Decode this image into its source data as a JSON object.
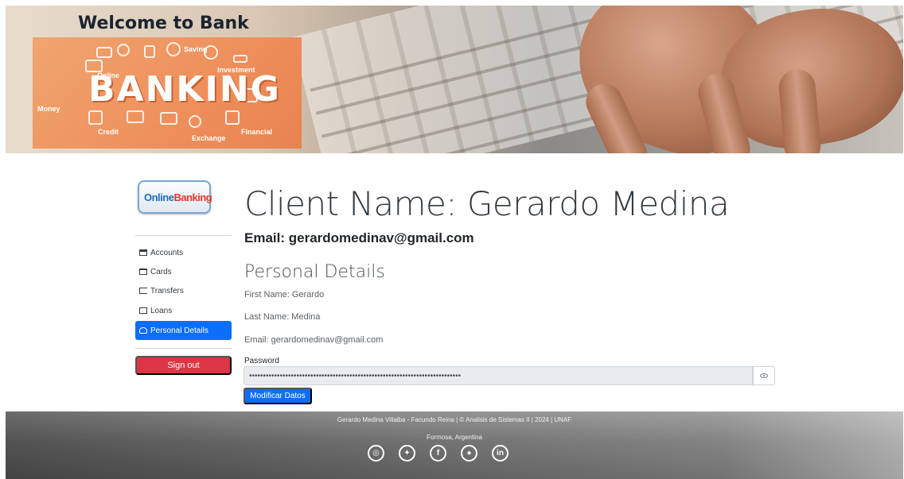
{
  "hero": {
    "title": "Welcome to Bank",
    "banner_text": "BANKING",
    "banner_words": [
      "Online",
      "Saving",
      "Investment",
      "Money",
      "Credit",
      "Exchange",
      "Financial"
    ]
  },
  "sidebar": {
    "logo_part1": "Online",
    "logo_part2": "Banking",
    "items": [
      {
        "label": "Accounts",
        "icon": "bank-icon"
      },
      {
        "label": "Cards",
        "icon": "credit-card-icon"
      },
      {
        "label": "Transfers",
        "icon": "transfer-icon"
      },
      {
        "label": "Loans",
        "icon": "cash-icon"
      },
      {
        "label": "Personal Details",
        "icon": "person-icon",
        "active": true
      }
    ],
    "signout_label": "Sign out"
  },
  "main": {
    "client_name": "Client Name: Gerardo Medina",
    "email_heading": "Email: gerardomedinav@gmail.com",
    "section_title": "Personal Details",
    "first_name": "First Name: Gerardo",
    "last_name": "Last Name: Medina",
    "email": "Email: gerardomedinav@gmail.com",
    "password_label": "Password",
    "password_value": "••••••••••••••••••••••••••••••••••••••••••••••••••••••••••••••••••••••••••••",
    "modify_button": "Modificar Datos"
  },
  "footer": {
    "credits": "Gerardo Medina Villalba - Facundo Reina | © Analisis de Sistemas II | 2024 | UNAF",
    "location": "Formosa, Argentina",
    "socials": [
      "instagram-icon",
      "twitter-icon",
      "facebook-icon",
      "github-icon",
      "linkedin-icon"
    ]
  },
  "colors": {
    "primary": "#0d6efd",
    "danger": "#dc3545",
    "banner_orange": "#ee8f5b"
  }
}
